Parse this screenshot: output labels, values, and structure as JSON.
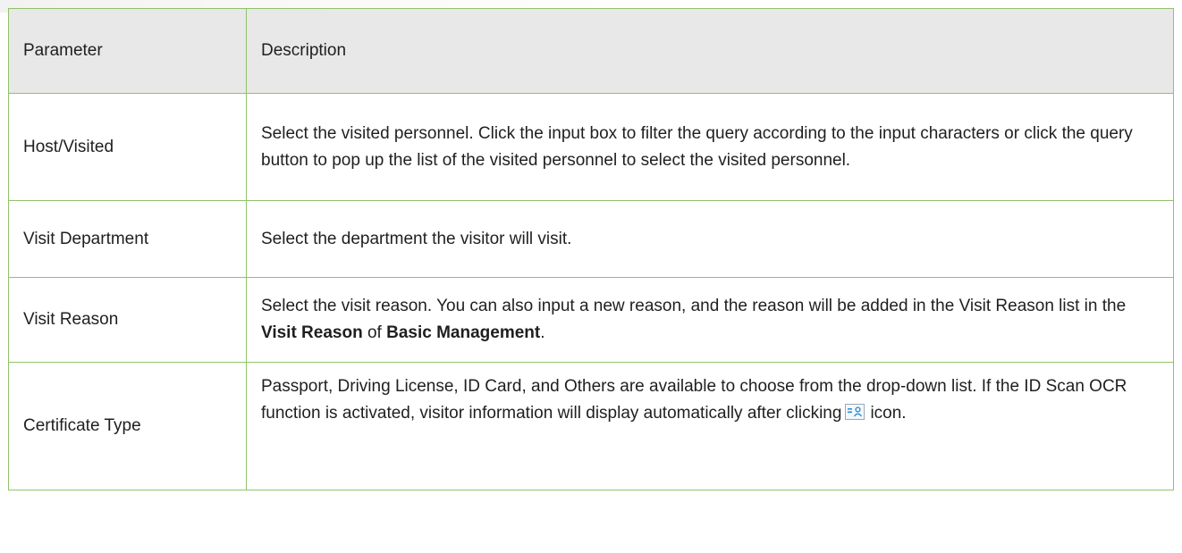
{
  "table": {
    "header": {
      "parameter": "Parameter",
      "description": "Description"
    },
    "rows": [
      {
        "parameter": "Host/Visited",
        "description": "Select the visited personnel. Click the input box to filter the query according to the input characters or click the query button to pop up the list of the visited personnel to select the visited personnel."
      },
      {
        "parameter": "Visit Department",
        "description": "Select the department the visitor will visit."
      },
      {
        "parameter": "Visit Reason",
        "description_pre": "Select the visit reason. You can also input a new reason, and the reason will be added in the Visit Reason list in the ",
        "description_bold1": "Visit Reason",
        "description_mid": " of ",
        "description_bold2": "Basic Management",
        "description_post": "."
      },
      {
        "parameter": "Certificate Type",
        "description_pre": "Passport, Driving License, ID Card, and Others are available to choose from the drop-down list. If the ID Scan OCR function is activated, visitor information will display automatically after clicking",
        "icon": "id-card-scan-icon",
        "description_post": "icon."
      }
    ]
  },
  "colors": {
    "border": "#8fc36a",
    "header_bg": "#e8e8e8",
    "icon_accent": "#2a8fd6"
  }
}
